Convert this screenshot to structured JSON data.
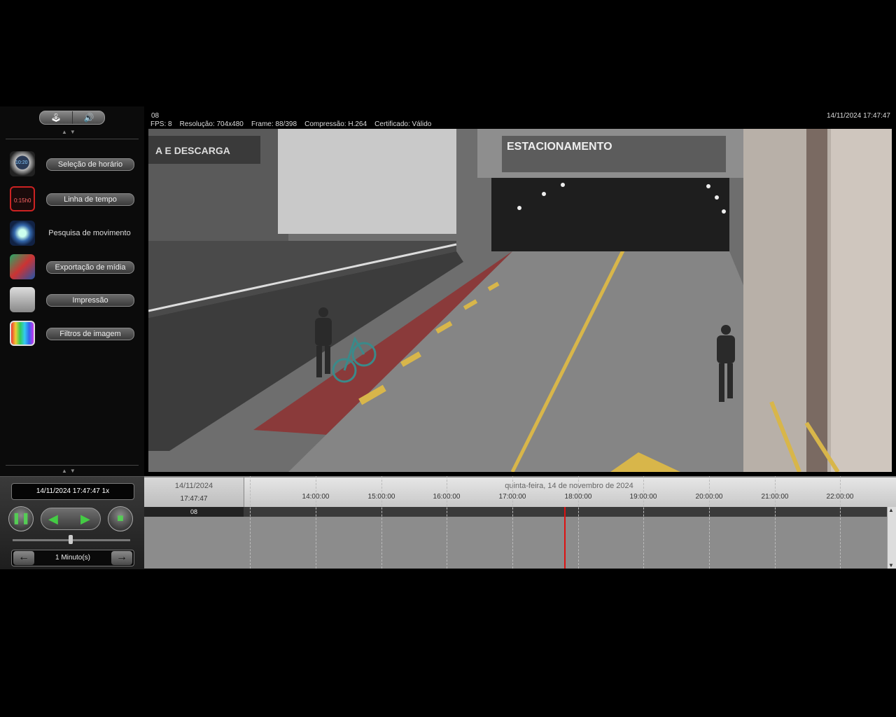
{
  "sidebar": {
    "toggle": {
      "left_icon": "joystick-icon",
      "right_icon": "speaker-icon",
      "left_glyph": "🕹",
      "right_glyph": "🔊"
    },
    "items": [
      {
        "label": "Seleção de horário",
        "icon": "clock-icon",
        "icon_text": "10:20"
      },
      {
        "label": "Linha de tempo",
        "icon": "timeline-clapper-icon",
        "icon_text": "0:15h0"
      },
      {
        "label": "Pesquisa de movimento",
        "icon": "motion-search-icon"
      },
      {
        "label": "Exportação de mídia",
        "icon": "media-export-icon"
      },
      {
        "label": "Impressão",
        "icon": "printer-icon"
      },
      {
        "label": "Filtros de imagem",
        "icon": "image-filter-icon"
      }
    ]
  },
  "video": {
    "camera_id": "08",
    "meta": "FPS: 8    Resolução: 704x480    Frame: 88/398    Compressão: H.264    Certificado: Válido",
    "timestamp": "14/11/2024 17:47:47",
    "scene_sign": "ESTACIONAMENTO",
    "scene_sign_left": "A E DESCARGA"
  },
  "controls": {
    "date_display": "14/11/2024 17:47:47 1x",
    "pause_glyph": "❚❚",
    "back_glyph": "◀",
    "play_glyph": "▶",
    "stop_glyph": "■",
    "step_label": "1 Minuto(s)",
    "step_prev": "←",
    "step_next": "→"
  },
  "timeline": {
    "current_date": "14/11/2024",
    "current_time": "17:47:47",
    "day_label": "quinta-feira, 14 de novembro de 2024",
    "ticks": [
      "14:00:00",
      "15:00:00",
      "16:00:00",
      "17:00:00",
      "18:00:00",
      "19:00:00",
      "20:00:00",
      "21:00:00",
      "22:00:00"
    ],
    "row_label": "08",
    "scroll_up": "▲",
    "scroll_down": "▼"
  }
}
